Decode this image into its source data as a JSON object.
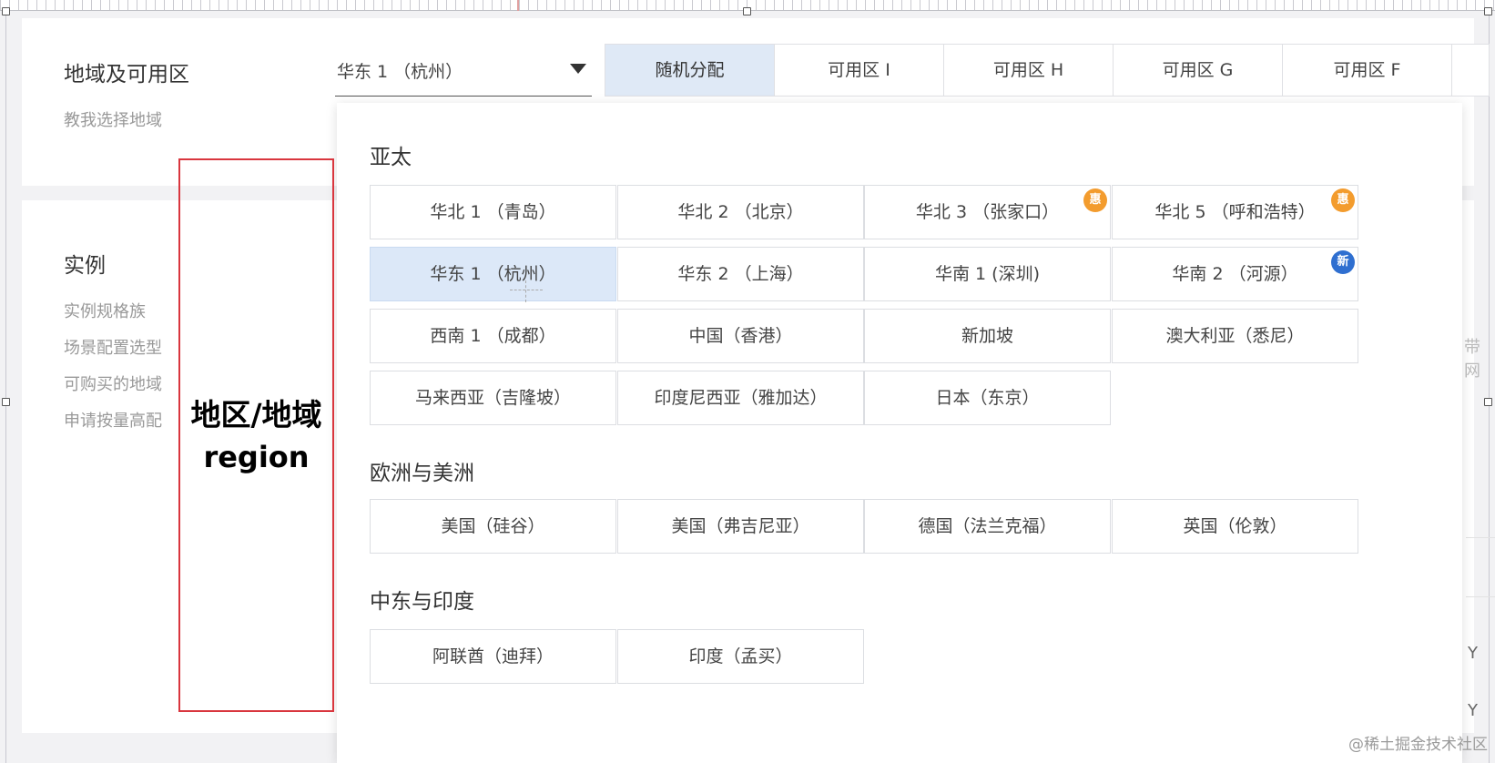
{
  "region_section": {
    "title": "地域及可用区",
    "help_link": "教我选择地域",
    "selected_region": "华东 1 （杭州）"
  },
  "zone_tabs": [
    "随机分配",
    "可用区 I",
    "可用区 H",
    "可用区 G",
    "可用区 F"
  ],
  "instance_section": {
    "title": "实例",
    "links": [
      "实例规格族",
      "场景配置选型",
      "可购买的地域",
      "申请按量高配"
    ]
  },
  "annotation": {
    "line1": "地区/地域",
    "line2": "region",
    "border_color": "#d9363e"
  },
  "dropdown": {
    "groups": [
      {
        "title": "亚太",
        "regions": [
          {
            "label": "华北 1 （青岛）"
          },
          {
            "label": "华北 2 （北京）"
          },
          {
            "label": "华北 3 （张家口）",
            "badge": "惠"
          },
          {
            "label": "华北 5 （呼和浩特）",
            "badge": "惠"
          },
          {
            "label": "华东 1 （杭州）",
            "selected": true
          },
          {
            "label": "华东 2 （上海）"
          },
          {
            "label": "华南 1 (深圳)"
          },
          {
            "label": "华南 2 （河源）",
            "badge": "新"
          },
          {
            "label": "西南 1 （成都）"
          },
          {
            "label": "中国（香港）"
          },
          {
            "label": "新加坡"
          },
          {
            "label": "澳大利亚（悉尼）"
          },
          {
            "label": "马来西亚（吉隆坡）"
          },
          {
            "label": "印度尼西亚（雅加达）"
          },
          {
            "label": "日本（东京）"
          }
        ]
      },
      {
        "title": "欧洲与美洲",
        "regions": [
          {
            "label": "美国（硅谷）"
          },
          {
            "label": "美国（弗吉尼亚）"
          },
          {
            "label": "德国（法兰克福）"
          },
          {
            "label": "英国（伦敦）"
          }
        ]
      },
      {
        "title": "中东与印度",
        "regions": [
          {
            "label": "阿联酋（迪拜）"
          },
          {
            "label": "印度（孟买）"
          }
        ]
      }
    ]
  },
  "background_fragments": {
    "right_edge_1": "带网",
    "right_edge_2": "Y",
    "right_edge_3": "Y"
  },
  "watermark": "@稀土掘金技术社区",
  "colors": {
    "accent_selected": "#dce8f8",
    "badge_discount": "#f39c2e",
    "badge_new": "#2f6fd0"
  }
}
